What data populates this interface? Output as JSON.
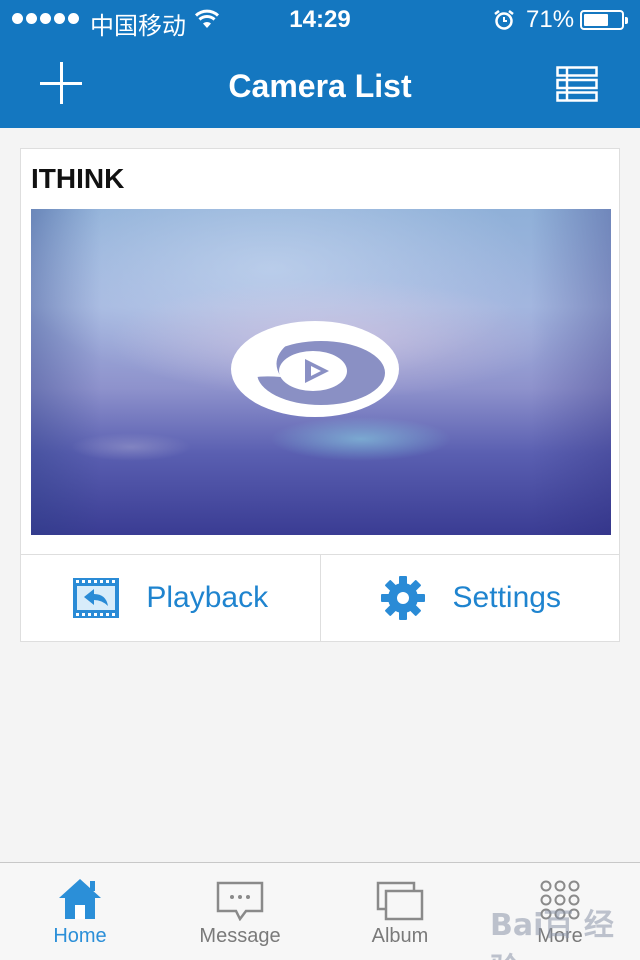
{
  "status_bar": {
    "carrier": "中国移动",
    "time": "14:29",
    "battery_percent": "71%",
    "battery_level": 0.71,
    "signal_dots": 5
  },
  "nav": {
    "title": "Camera List",
    "left_icon": "plus-icon",
    "right_icon": "list-view-icon"
  },
  "camera": {
    "name": "ITHINK",
    "play_icon": "play-logo-icon",
    "actions": {
      "playback": "Playback",
      "settings": "Settings"
    }
  },
  "tabs": [
    {
      "label": "Home",
      "icon": "home-icon",
      "active": true
    },
    {
      "label": "Message",
      "icon": "message-icon",
      "active": false
    },
    {
      "label": "Album",
      "icon": "album-icon",
      "active": false
    },
    {
      "label": "More",
      "icon": "more-grid-icon",
      "active": false
    }
  ],
  "colors": {
    "header": "#1477c0",
    "accent": "#1f84cf",
    "tab_active": "#2b8fd8"
  },
  "watermark": "Bai百 经验"
}
